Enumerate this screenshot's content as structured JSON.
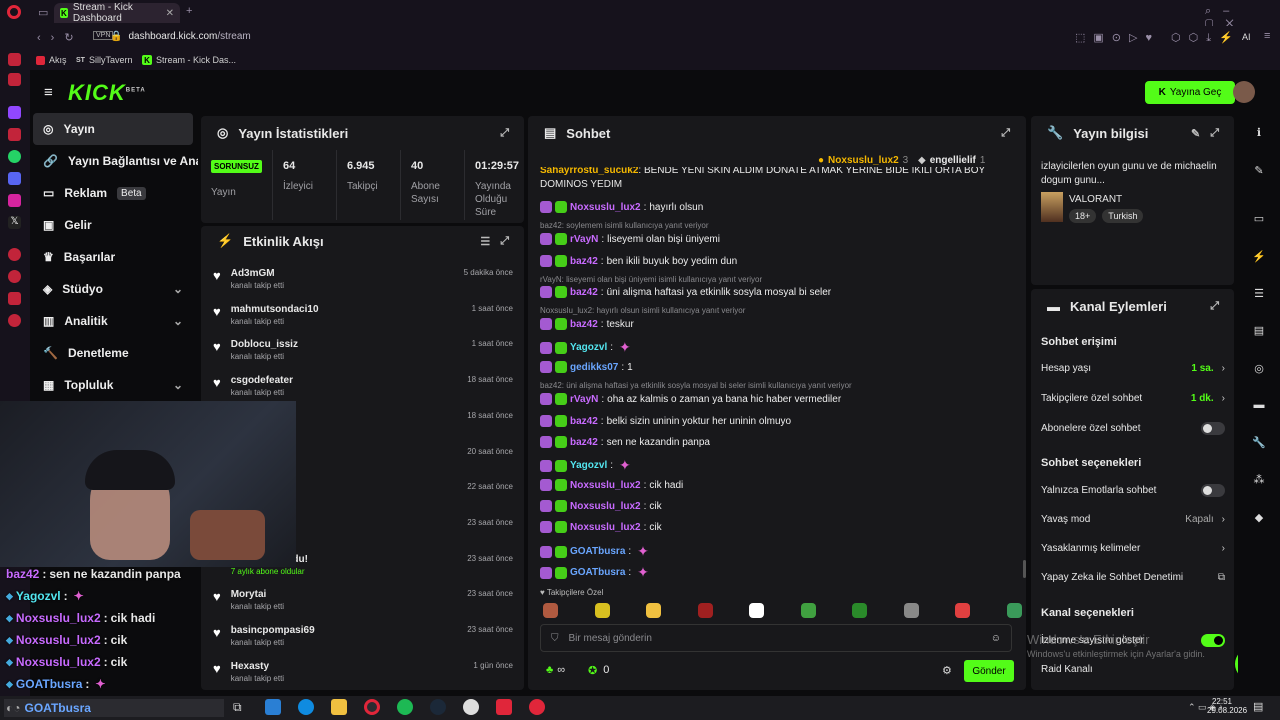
{
  "browser": {
    "tab_title": "Stream - Kick Dashboard",
    "url_domain": "dashboard.kick.com",
    "url_path": "/stream",
    "vpn": "VPN",
    "bookmarks": [
      "Akış",
      "SillyTavern",
      "Stream - Kick Das..."
    ],
    "ai": "AI"
  },
  "header": {
    "logo": "KICK",
    "beta": "BETA",
    "go_live": "Yayına Geç"
  },
  "nav": [
    {
      "label": "Yayın",
      "icon": "target-icon"
    },
    {
      "label": "Yayın Bağlantısı ve Anahtarı",
      "icon": "link-icon"
    },
    {
      "label": "Reklam",
      "beta": "Beta",
      "icon": "ad-icon"
    },
    {
      "label": "Gelir",
      "icon": "money-icon"
    },
    {
      "label": "Başarılar",
      "icon": "trophy-icon"
    },
    {
      "label": "Stüdyo",
      "icon": "studio-icon"
    },
    {
      "label": "Analitik",
      "icon": "chart-icon"
    },
    {
      "label": "Denetleme",
      "icon": "hammer-icon"
    },
    {
      "label": "Topluluk",
      "icon": "community-icon"
    }
  ],
  "stats": {
    "title": "Yayın İstatistikleri",
    "status": "SORUNSUZ",
    "status_label": "Yayın",
    "items": [
      {
        "value": "64",
        "label": "İzleyici"
      },
      {
        "value": "6.945",
        "label": "Takipçi"
      },
      {
        "value": "40",
        "label": "Abone Sayısı"
      },
      {
        "value": "01:29:57",
        "label": "Yayında Olduğu Süre"
      }
    ]
  },
  "activity": {
    "title": "Etkinlik Akışı",
    "rows": [
      {
        "name": "Ad3mGM",
        "sub": "kanalı takip etti",
        "time": "5 dakika önce"
      },
      {
        "name": "mahmutsondaci10",
        "sub": "kanalı takip etti",
        "time": "1 saat önce"
      },
      {
        "name": "Doblocu_issiz",
        "sub": "kanalı takip etti",
        "time": "1 saat önce"
      },
      {
        "name": "csgodefeater",
        "sub": "kanalı takip etti",
        "time": "18 saat önce"
      },
      {
        "name": "",
        "sub": "",
        "time": "18 saat önce"
      },
      {
        "name": "mZ",
        "sub": "",
        "time": "20 saat önce"
      },
      {
        "name": "omaab",
        "sub": "",
        "time": "22 saat önce"
      },
      {
        "name": "",
        "sub": "",
        "time": "23 saat önce"
      },
      {
        "name": "den abone oldu!",
        "sub": "7 aylık abone oldular",
        "time": "23 saat önce"
      },
      {
        "name": "Morytai",
        "sub": "kanalı takip etti",
        "time": "23 saat önce"
      },
      {
        "name": "basincpompasi69",
        "sub": "kanalı takip etti",
        "time": "23 saat önce"
      },
      {
        "name": "Hexasty",
        "sub": "kanalı takip etti",
        "time": "1 gün önce"
      }
    ]
  },
  "chat": {
    "title": "Sohbet",
    "pinned": [
      {
        "name": "Noxsuslu_lux2",
        "count": "3"
      },
      {
        "name": "engellielif",
        "count": "1"
      }
    ],
    "top_text": "BENDE YENI SKIN ALDIM DONATE ATMAK YERINE BIDE IKILI ORTA BOY",
    "top_text2": "DOMINOS YEDIM",
    "top_user": "Sahayrrostu_sucuk2",
    "lines": [
      {
        "user": "Noxsuslu_lux2",
        "color": "#c86bff",
        "msg": "hayırlı olsun"
      },
      {
        "reply": "baz42: soylemem isimli kullanıcıya yanıt veriyor"
      },
      {
        "user": "rVayN",
        "color": "#c86bff",
        "msg": "liseyemi olan bişi üniyemi"
      },
      {
        "user": "baz42",
        "color": "#c86bff",
        "msg": "ben ikili buyuk boy yedim dun"
      },
      {
        "reply": "rVayN: liseyemi olan bişi üniyemi isimli kullanıcıya yanıt veriyor"
      },
      {
        "user": "baz42",
        "color": "#c86bff",
        "msg": "üni alişma haftasi ya etkinlik sosyla mosyal bi seler"
      },
      {
        "reply": "Noxsuslu_lux2: hayırlı olsun isimli kullanıcıya yanıt veriyor"
      },
      {
        "user": "baz42",
        "color": "#c86bff",
        "msg": "teskur"
      },
      {
        "user": "Yagozvl",
        "color": "#53e6f0",
        "msg": ""
      },
      {
        "user": "gedikks07",
        "color": "#6aa6ff",
        "msg": "1"
      },
      {
        "reply": "baz42: üni alişma haftasi ya etkinlik sosyla mosyal bi seler isimli kullanıcıya yanıt veriyor"
      },
      {
        "user": "rVayN",
        "color": "#c86bff",
        "msg": "oha az kalmis o zaman ya bana hic haber vermediler"
      },
      {
        "user": "baz42",
        "color": "#c86bff",
        "msg": "belki sizin uninin yoktur her uninin olmuyo"
      },
      {
        "user": "baz42",
        "color": "#c86bff",
        "msg": "sen ne kazandin panpa"
      },
      {
        "user": "Yagozvl",
        "color": "#53e6f0",
        "msg": ""
      },
      {
        "user": "Noxsuslu_lux2",
        "color": "#c86bff",
        "msg": "cik hadi"
      },
      {
        "user": "Noxsuslu_lux2",
        "color": "#c86bff",
        "msg": "cik"
      },
      {
        "user": "Noxsuslu_lux2",
        "color": "#c86bff",
        "msg": "cik"
      },
      {
        "user": "GOATbusra",
        "color": "#6aa6ff",
        "msg": ""
      },
      {
        "user": "GOATbusra",
        "color": "#6aa6ff",
        "msg": ""
      }
    ],
    "emote_label": "Takipçilere Özel",
    "placeholder": "Bir mesaj gönderin",
    "inf": "∞",
    "points": "0",
    "send": "Gönder"
  },
  "info": {
    "title": "Yayın bilgisi",
    "stream_title": "izlayicilerlen oyun gunu ve de michaelin dogum gunu...",
    "game": "VALORANT",
    "tags": [
      "18+",
      "Turkish"
    ]
  },
  "actions": {
    "title": "Kanal Eylemleri",
    "chat_access": "Sohbet erişimi",
    "account_age": "Hesap yaşı",
    "account_age_val": "1 sa.",
    "followers_only": "Takipçilere özel sohbet",
    "followers_only_val": "1 dk.",
    "subs_only": "Abonelere özel sohbet",
    "chat_options": "Sohbet seçenekleri",
    "emotes_only": "Yalnızca Emotlarla sohbet",
    "slow": "Yavaş mod",
    "slow_val": "Kapalı",
    "banned_words": "Yasaklanmış kelimeler",
    "ai_mod": "Yapay Zeka ile Sohbet Denetimi",
    "channel_options": "Kanal seçenekleri",
    "show_viewers": "İzlenme sayısını göster",
    "raid": "Raid Kanalı"
  },
  "windows_watermark": [
    "Windows'u Etkinleştir",
    "Windows'u etkinleştirmek için Ayarlar'a gidin."
  ],
  "overlay": [
    {
      "user": "baz42",
      "color": "#c86bff",
      "msg": "sen ne kazandin panpa"
    },
    {
      "user": "Yagozvl",
      "color": "#53e6f0",
      "msg": ""
    },
    {
      "user": "Noxsuslu_lux2",
      "color": "#c86bff",
      "msg": "cik hadi"
    },
    {
      "user": "Noxsuslu_lux2",
      "color": "#c86bff",
      "msg": "cik"
    },
    {
      "user": "Noxsuslu_lux2",
      "color": "#c86bff",
      "msg": "cik"
    },
    {
      "user": "GOATbusra",
      "color": "#6aa6ff",
      "msg": ""
    }
  ],
  "taskbar": {
    "time": "22:51",
    "date": "29.08.2026",
    "pinned_user": "GOATbusra"
  }
}
